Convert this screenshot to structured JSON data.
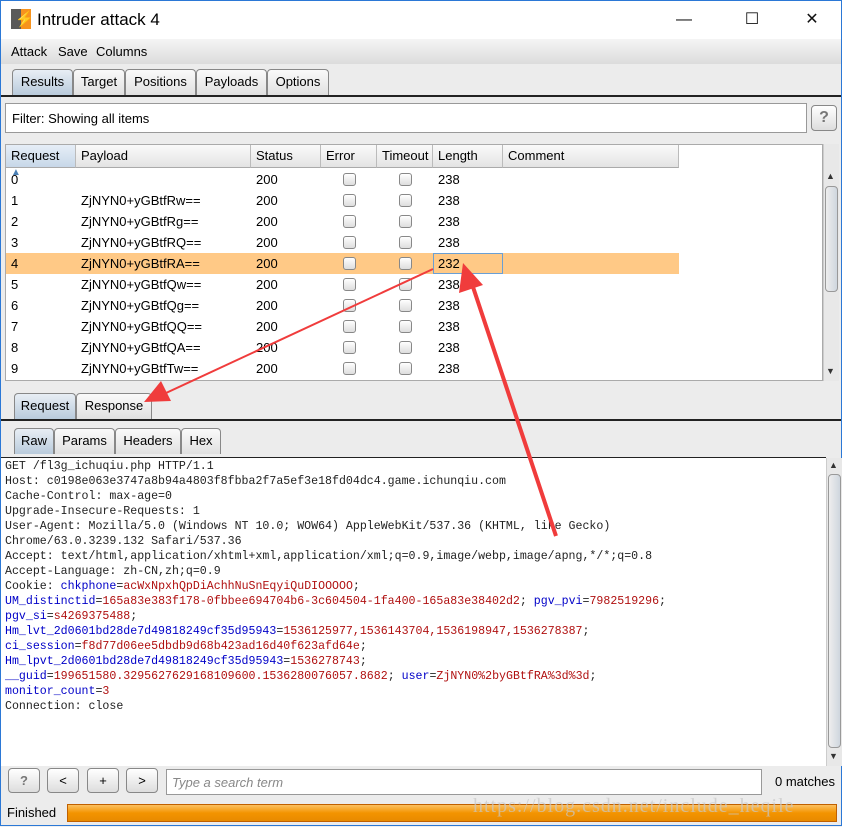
{
  "window": {
    "title": "Intruder attack 4",
    "controls": {
      "minimize": "—",
      "maximize": "☐",
      "close": "✕"
    }
  },
  "menu": [
    "Attack",
    "Save",
    "Columns"
  ],
  "tabs": [
    "Results",
    "Target",
    "Positions",
    "Payloads",
    "Options"
  ],
  "filter": "Filter: Showing all items",
  "help_label": "?",
  "table": {
    "columns": [
      "Request",
      "Payload",
      "Status",
      "Error",
      "Timeout",
      "Length",
      "Comment"
    ],
    "sorted_column": "Request",
    "sort_indicator": "▲",
    "selected_row": 4,
    "rows": [
      {
        "request": "0",
        "payload": "",
        "status": "200",
        "error": false,
        "timeout": false,
        "length": "238",
        "comment": ""
      },
      {
        "request": "1",
        "payload": "ZjNYN0+yGBtfRw==",
        "status": "200",
        "error": false,
        "timeout": false,
        "length": "238",
        "comment": ""
      },
      {
        "request": "2",
        "payload": "ZjNYN0+yGBtfRg==",
        "status": "200",
        "error": false,
        "timeout": false,
        "length": "238",
        "comment": ""
      },
      {
        "request": "3",
        "payload": "ZjNYN0+yGBtfRQ==",
        "status": "200",
        "error": false,
        "timeout": false,
        "length": "238",
        "comment": ""
      },
      {
        "request": "4",
        "payload": "ZjNYN0+yGBtfRA==",
        "status": "200",
        "error": false,
        "timeout": false,
        "length": "232",
        "comment": ""
      },
      {
        "request": "5",
        "payload": "ZjNYN0+yGBtfQw==",
        "status": "200",
        "error": false,
        "timeout": false,
        "length": "238",
        "comment": ""
      },
      {
        "request": "6",
        "payload": "ZjNYN0+yGBtfQg==",
        "status": "200",
        "error": false,
        "timeout": false,
        "length": "238",
        "comment": ""
      },
      {
        "request": "7",
        "payload": "ZjNYN0+yGBtfQQ==",
        "status": "200",
        "error": false,
        "timeout": false,
        "length": "238",
        "comment": ""
      },
      {
        "request": "8",
        "payload": "ZjNYN0+yGBtfQA==",
        "status": "200",
        "error": false,
        "timeout": false,
        "length": "238",
        "comment": ""
      },
      {
        "request": "9",
        "payload": "ZjNYN0+yGBtfTw==",
        "status": "200",
        "error": false,
        "timeout": false,
        "length": "238",
        "comment": ""
      }
    ]
  },
  "message_tabs": [
    "Request",
    "Response"
  ],
  "view_tabs": [
    "Raw",
    "Params",
    "Headers",
    "Hex"
  ],
  "colors": {
    "selected_row": "#ffc986",
    "cookie_name": "#0000c8",
    "cookie_value": "#b01010",
    "progress": "#f39400",
    "annotation_arrow": "#f03c3c"
  },
  "request_lines": [
    [
      {
        "t": "GET /fl3g_ichuqiu.php HTTP/1.1"
      }
    ],
    [
      {
        "t": "Host: c0198e063e3747a8b94a4803f8fbba2f7a5ef3e18fd04dc4.game.ichunqiu.com"
      }
    ],
    [
      {
        "t": "Cache-Control: max-age=0"
      }
    ],
    [
      {
        "t": "Upgrade-Insecure-Requests: 1"
      }
    ],
    [
      {
        "t": "User-Agent: Mozilla/5.0 (Windows NT 10.0; WOW64) AppleWebKit/537.36 (KHTML, like Gecko)"
      }
    ],
    [
      {
        "t": "Chrome/63.0.3239.132 Safari/537.36"
      }
    ],
    [
      {
        "t": "Accept: text/html,application/xhtml+xml,application/xml;q=0.9,image/webp,image/apng,*/*;q=0.8"
      }
    ],
    [
      {
        "t": "Accept-Language: zh-CN,zh;q=0.9"
      }
    ],
    [
      {
        "t": "Cookie: "
      },
      {
        "t": "chkphone",
        "c": "k"
      },
      {
        "t": "="
      },
      {
        "t": "acWxNpxhQpDiAchhNuSnEqyiQuDIOOOOO",
        "c": "v"
      },
      {
        "t": ";"
      }
    ],
    [
      {
        "t": "UM_distinctid",
        "c": "k"
      },
      {
        "t": "="
      },
      {
        "t": "165a83e383f178-0fbbee694704b6-3c604504-1fa400-165a83e38402d2",
        "c": "v"
      },
      {
        "t": "; "
      },
      {
        "t": "pgv_pvi",
        "c": "k"
      },
      {
        "t": "="
      },
      {
        "t": "7982519296",
        "c": "v"
      },
      {
        "t": ";"
      }
    ],
    [
      {
        "t": "pgv_si",
        "c": "k"
      },
      {
        "t": "="
      },
      {
        "t": "s4269375488",
        "c": "v"
      },
      {
        "t": ";"
      }
    ],
    [
      {
        "t": "Hm_lvt_2d0601bd28de7d49818249cf35d95943",
        "c": "k"
      },
      {
        "t": "="
      },
      {
        "t": "1536125977,1536143704,1536198947,1536278387",
        "c": "v"
      },
      {
        "t": ";"
      }
    ],
    [
      {
        "t": "ci_session",
        "c": "k"
      },
      {
        "t": "="
      },
      {
        "t": "f8d77d06ee5dbdb9d68b423ad16d40f623afd64e",
        "c": "v"
      },
      {
        "t": ";"
      }
    ],
    [
      {
        "t": "Hm_lpvt_2d0601bd28de7d49818249cf35d95943",
        "c": "k"
      },
      {
        "t": "="
      },
      {
        "t": "1536278743",
        "c": "v"
      },
      {
        "t": ";"
      }
    ],
    [
      {
        "t": "__guid",
        "c": "k"
      },
      {
        "t": "="
      },
      {
        "t": "199651580.3295627629168109600.1536280076057.8682",
        "c": "v"
      },
      {
        "t": "; "
      },
      {
        "t": "user",
        "c": "k"
      },
      {
        "t": "="
      },
      {
        "t": "ZjNYN0%2byGBtfRA%3d%3d",
        "c": "v"
      },
      {
        "t": ";"
      }
    ],
    [
      {
        "t": "monitor_count",
        "c": "k"
      },
      {
        "t": "="
      },
      {
        "t": "3",
        "c": "v"
      }
    ],
    [
      {
        "t": "Connection: close"
      }
    ]
  ],
  "search": {
    "buttons": [
      "?",
      "<",
      "+",
      ">"
    ],
    "placeholder": "Type a search term",
    "matches": "0 matches"
  },
  "status": {
    "text": "Finished",
    "progress_percent": 100
  },
  "watermark": "https://blog.csdn.net/include_heqile"
}
